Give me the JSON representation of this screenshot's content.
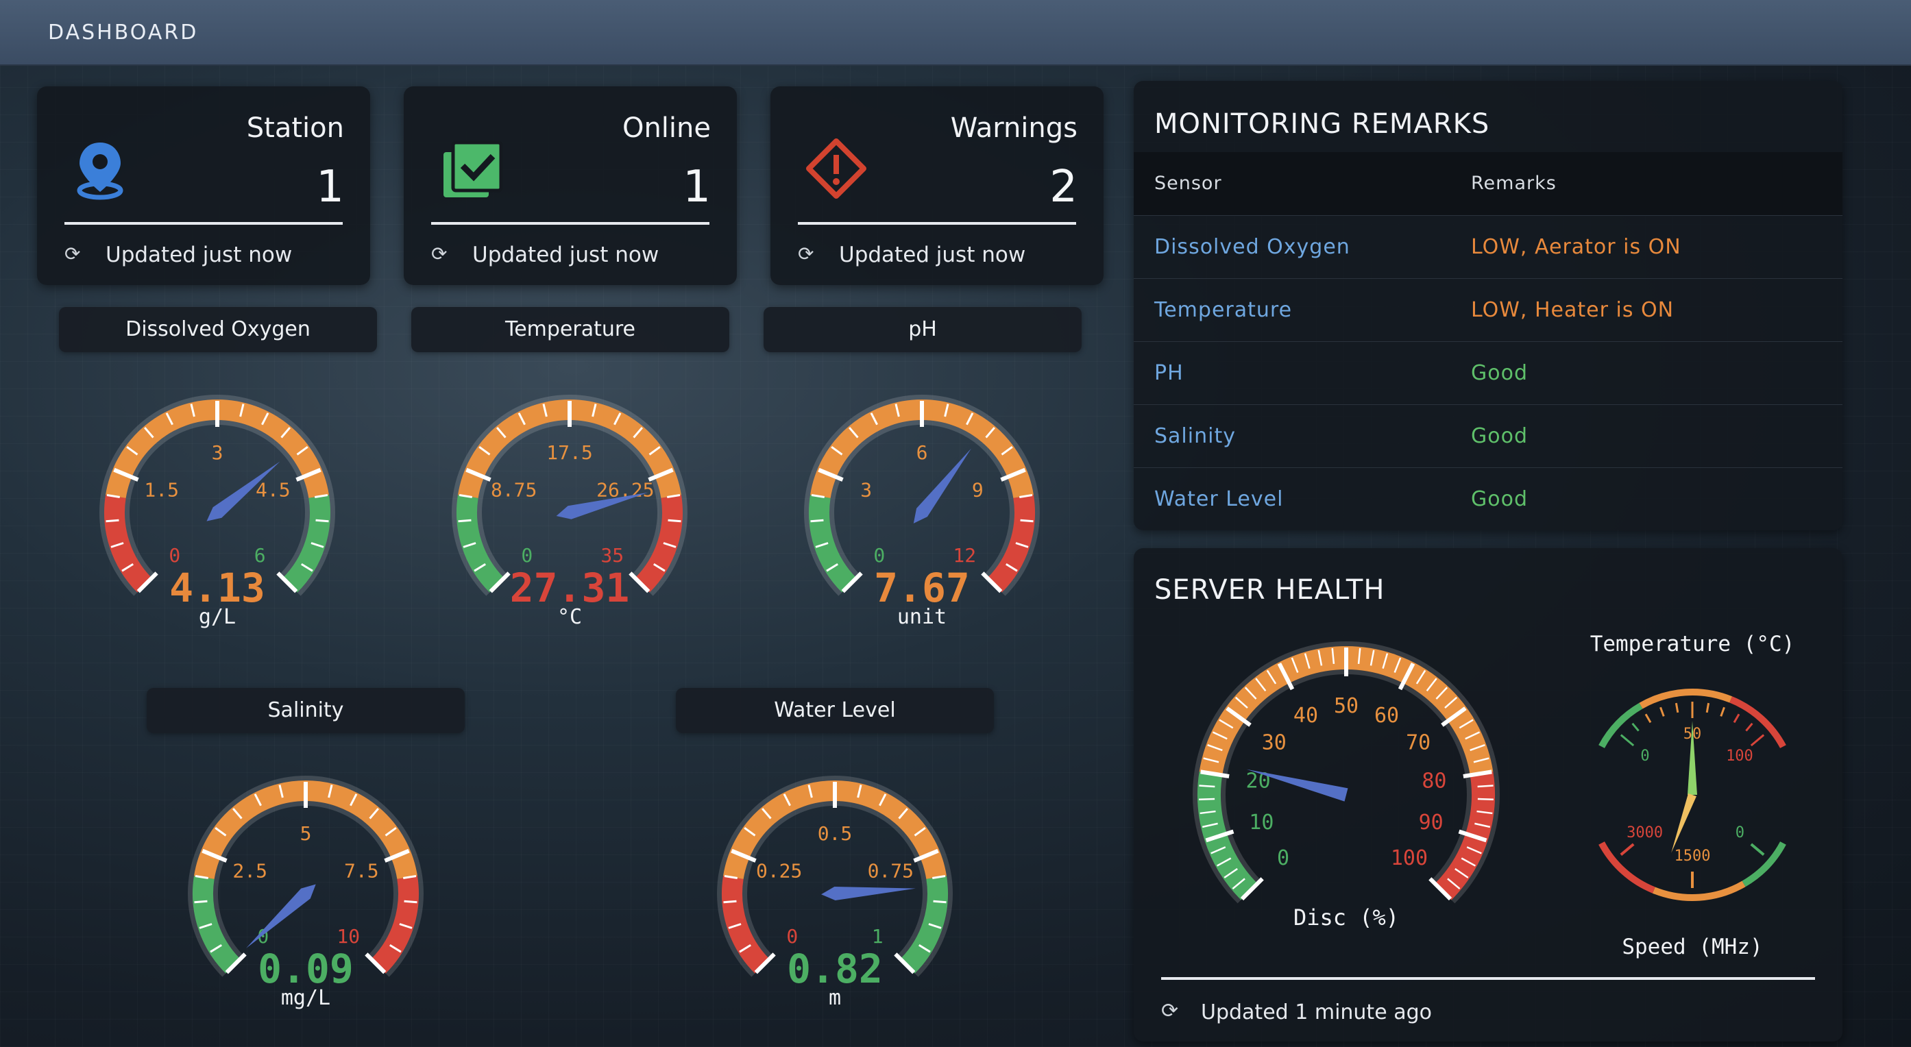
{
  "header": {
    "title": "DASHBOARD"
  },
  "stats": [
    {
      "label": "Station",
      "value": "1",
      "updated": "Updated just now",
      "icon": "location-pin-icon",
      "color": "#3b7fd9"
    },
    {
      "label": "Online",
      "value": "1",
      "updated": "Updated just now",
      "icon": "check-list-icon",
      "color": "#4cb86a"
    },
    {
      "label": "Warnings",
      "value": "2",
      "updated": "Updated just now",
      "icon": "warning-diamond-icon",
      "color": "#d2432f"
    }
  ],
  "gauges": [
    {
      "title": "Dissolved Oxygen",
      "value": "4.13",
      "num": 4.13,
      "unit": "g/L",
      "min": 0,
      "max": 6,
      "labels": [
        "0",
        "1.5",
        "3",
        "4.5",
        "6"
      ],
      "zones": [
        "red",
        "orange",
        "green"
      ],
      "value_color": "#e8893c"
    },
    {
      "title": "Temperature",
      "value": "27.31",
      "num": 27.31,
      "unit": "°C",
      "min": 0,
      "max": 35,
      "labels": [
        "0",
        "8.75",
        "17.5",
        "26.25",
        "35"
      ],
      "zones": [
        "green",
        "orange",
        "red"
      ],
      "value_color": "#d8453a"
    },
    {
      "title": "pH",
      "value": "7.67",
      "num": 7.67,
      "unit": "unit",
      "min": 0,
      "max": 12,
      "labels": [
        "0",
        "3",
        "6",
        "9",
        "12"
      ],
      "zones": [
        "green",
        "orange",
        "red"
      ],
      "value_color": "#e8893c"
    },
    {
      "title": "Salinity",
      "value": "0.09",
      "num": 0.09,
      "unit": "mg/L",
      "min": 0,
      "max": 10,
      "labels": [
        "0",
        "2.5",
        "5",
        "7.5",
        "10"
      ],
      "zones": [
        "green",
        "orange",
        "red"
      ],
      "value_color": "#4cae63"
    },
    {
      "title": "Water Level",
      "value": "0.82",
      "num": 0.82,
      "unit": "m",
      "min": 0,
      "max": 1,
      "labels": [
        "0",
        "0.25",
        "0.5",
        "0.75",
        "1"
      ],
      "zones": [
        "red",
        "orange",
        "green"
      ],
      "value_color": "#4cae63"
    }
  ],
  "remarks": {
    "title": "MONITORING REMARKS",
    "col_sensor": "Sensor",
    "col_remarks": "Remarks",
    "rows": [
      {
        "sensor": "Dissolved Oxygen",
        "remark": "LOW, Aerator is ON",
        "color": "#e8893c"
      },
      {
        "sensor": "Temperature",
        "remark": "LOW, Heater is ON",
        "color": "#e8893c"
      },
      {
        "sensor": "PH",
        "remark": "Good",
        "color": "#5fc06a"
      },
      {
        "sensor": "Salinity",
        "remark": "Good",
        "color": "#5fc06a"
      },
      {
        "sensor": "Water Level",
        "remark": "Good",
        "color": "#5fc06a"
      }
    ],
    "sensor_color": "#6fa7e0"
  },
  "server": {
    "title": "SERVER HEALTH",
    "disc_label": "Disc (%)",
    "disc_value": 22,
    "disc_labels": [
      "0",
      "10",
      "20",
      "30",
      "40",
      "50",
      "60",
      "70",
      "80",
      "90",
      "100"
    ],
    "temp_label": "Temperature (°C)",
    "temp_labels": [
      "0",
      "50",
      "100"
    ],
    "speed_label": "Speed (MHz)",
    "speed_labels": [
      "3000",
      "1500",
      "0"
    ],
    "updated": "Updated 1 minute ago"
  },
  "colors": {
    "red": "#d8453a",
    "orange": "#e8913f",
    "green": "#4cae63",
    "needle": "#5470c6"
  }
}
